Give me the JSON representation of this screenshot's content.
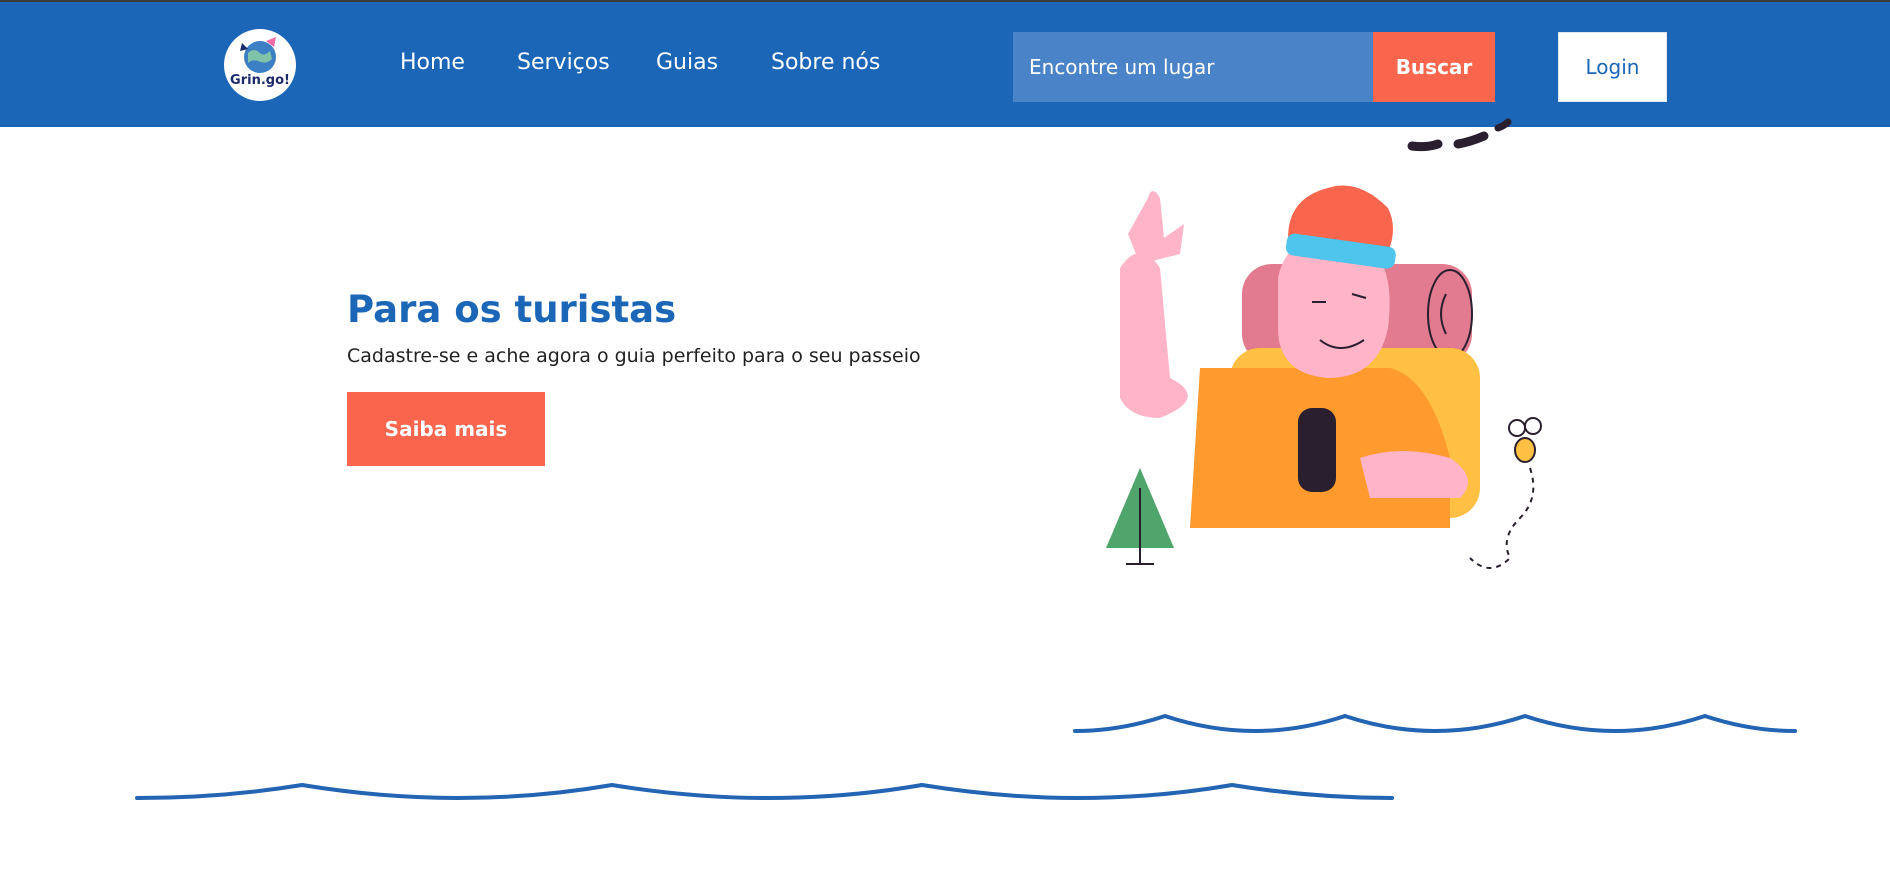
{
  "header": {
    "logo_text": "Grin.go!",
    "nav": [
      "Home",
      "Serviços",
      "Guias",
      "Sobre nós"
    ],
    "search_placeholder": "Encontre um lugar",
    "search_button": "Buscar",
    "login_button": "Login"
  },
  "hero": {
    "title": "Para os turistas",
    "subtitle": "Cadastre-se e ache agora o guia perfeito para o seu passeio",
    "cta": "Saiba mais"
  },
  "colors": {
    "header_bg": "#1c66b8",
    "accent": "#f9654d",
    "title": "#1c66b8"
  }
}
